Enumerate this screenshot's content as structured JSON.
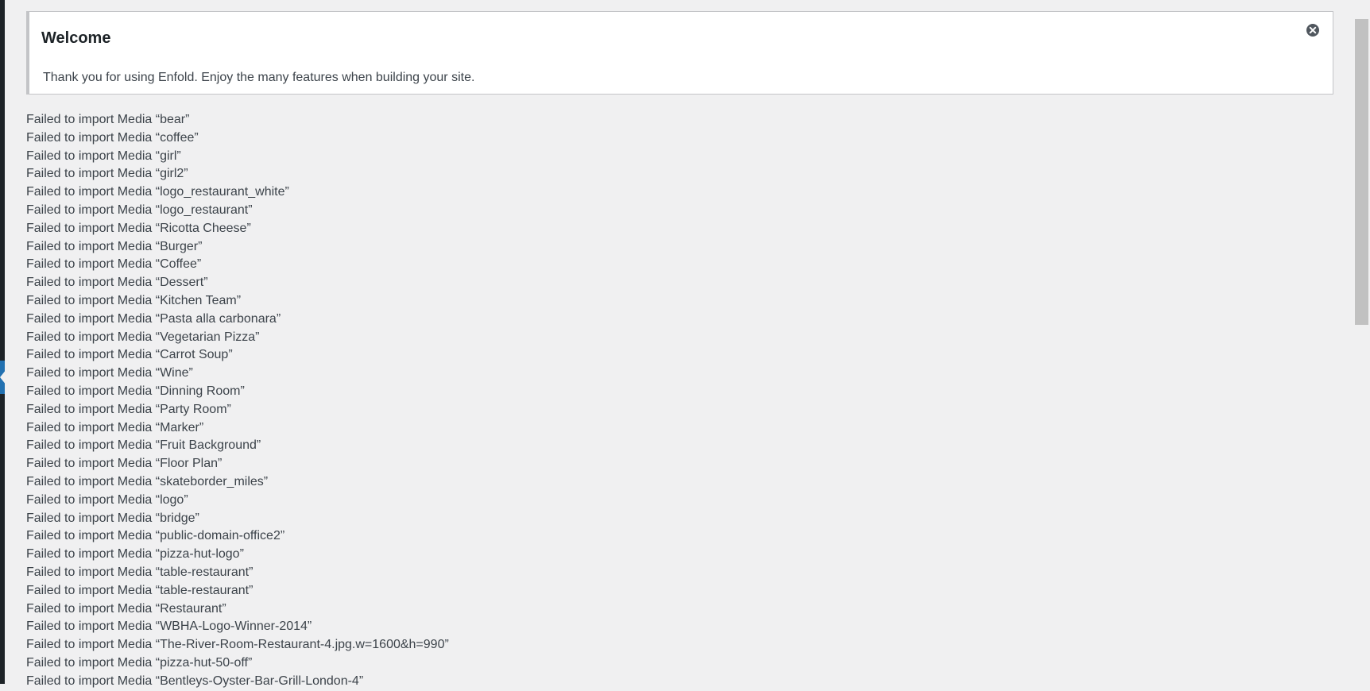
{
  "notice": {
    "title": "Welcome",
    "text": "Thank you for using Enfold. Enjoy the many features when building your site.",
    "dismiss_icon": "close-circle-icon"
  },
  "import_log": [
    "Failed to import Media “bear”",
    "Failed to import Media “coffee”",
    "Failed to import Media “girl”",
    "Failed to import Media “girl2”",
    "Failed to import Media “logo_restaurant_white”",
    "Failed to import Media “logo_restaurant”",
    "Failed to import Media “Ricotta Cheese”",
    "Failed to import Media “Burger”",
    "Failed to import Media “Coffee”",
    "Failed to import Media “Dessert”",
    "Failed to import Media “Kitchen Team”",
    "Failed to import Media “Pasta alla carbonara”",
    "Failed to import Media “Vegetarian Pizza”",
    "Failed to import Media “Carrot Soup”",
    "Failed to import Media “Wine”",
    "Failed to import Media “Dinning Room”",
    "Failed to import Media “Party Room”",
    "Failed to import Media “Marker”",
    "Failed to import Media “Fruit Background”",
    "Failed to import Media “Floor Plan”",
    "Failed to import Media “skateborder_miles”",
    "Failed to import Media “logo”",
    "Failed to import Media “bridge”",
    "Failed to import Media “public-domain-office2”",
    "Failed to import Media “pizza-hut-logo”",
    "Failed to import Media “table-restaurant”",
    "Failed to import Media “table-restaurant”",
    "Failed to import Media “Restaurant”",
    "Failed to import Media “WBHA-Logo-Winner-2014”",
    "Failed to import Media “The-River-Room-Restaurant-4.jpg.w=1600&h=990”",
    "Failed to import Media “pizza-hut-50-off”",
    "Failed to import Media “Bentleys-Oyster-Bar-Grill-London-4”"
  ],
  "colors": {
    "background": "#f0f0f1",
    "sidebar": "#1d2327",
    "sidebar_active": "#2271b1",
    "text": "#3c434a",
    "notice_border": "#c3c4c7"
  }
}
